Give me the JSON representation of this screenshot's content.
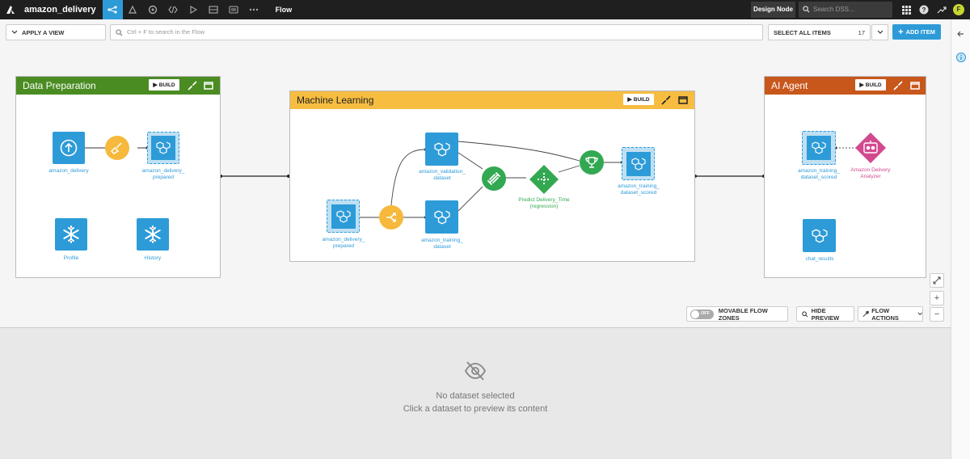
{
  "topbar": {
    "project_name": "amazon_delivery",
    "current_view": "Flow",
    "node_label": "Design Node",
    "search_placeholder": "Search DSS...",
    "avatar_initial": "F",
    "nav_icons": [
      "flow-icon",
      "lab-icon",
      "ml-icon",
      "code-icon",
      "run-icon",
      "dashboard-icon",
      "wiki-icon",
      "more-icon"
    ]
  },
  "toolbar": {
    "apply_view_label": "APPLY A VIEW",
    "search_placeholder": "Ctrl + F to search in the Flow",
    "select_all_label": "SELECT ALL ITEMS",
    "item_count": "17",
    "add_item_label": "ADD ITEM"
  },
  "zones": {
    "data_prep": {
      "title": "Data Preparation",
      "color": "#4a8c22",
      "build_label": "BUILD",
      "nodes": {
        "amazon_delivery": "amazon_delivery",
        "prepared": "amazon_delivery_\nprepared",
        "profile": "Profile",
        "history": "History"
      }
    },
    "ml": {
      "title": "Machine Learning",
      "color": "#f6bd41",
      "build_label": "BUILD",
      "nodes": {
        "prepared": "amazon_delivery_\nprepared",
        "validation": "amazon_validation_\ndataset",
        "training": "amazon_training_\ndataset",
        "model": "Predict Delivery_Time\n(regression)",
        "scored": "amazon_training_\ndataset_scored"
      }
    },
    "ai": {
      "title": "AI Agent",
      "color": "#c8571c",
      "build_label": "BUILD",
      "nodes": {
        "scored": "amazon_training_\ndataset_scored",
        "agent": "Amazon Delivery\nAnalyzer",
        "chat": "chat_results"
      }
    }
  },
  "controls": {
    "movable_toggle_state": "OFF",
    "movable_label": "MOVABLE FLOW ZONES",
    "hide_preview_label": "HIDE PREVIEW",
    "flow_actions_label": "FLOW ACTIONS",
    "zoom_in": "+",
    "zoom_out": "−"
  },
  "preview": {
    "title": "No dataset selected",
    "subtitle": "Click a dataset to preview its content"
  }
}
